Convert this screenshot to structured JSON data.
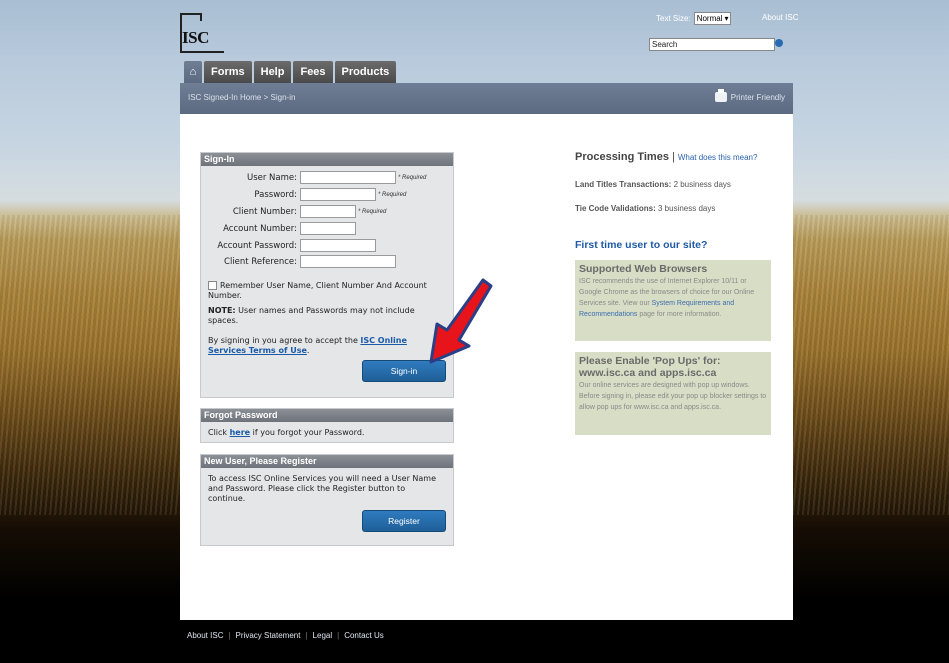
{
  "header": {
    "logo_text": "ISC",
    "text_size_label": "Text Size:",
    "text_size_value": "Normal",
    "about_label": "About ISC",
    "search_value": "Search"
  },
  "tabs": [
    {
      "label": ""
    },
    {
      "label": "Forms"
    },
    {
      "label": "Help"
    },
    {
      "label": "Fees"
    },
    {
      "label": "Products"
    }
  ],
  "breadcrumb": {
    "home": "ISC Signed-In Home",
    "sep": ">",
    "current": "Sign-in"
  },
  "printer_label": "Printer Friendly",
  "signin": {
    "title": "Sign-In",
    "fields": [
      {
        "label": "User Name:",
        "required": "* Required"
      },
      {
        "label": "Password:",
        "required": "* Required"
      },
      {
        "label": "Client Number:",
        "required": "* Required"
      },
      {
        "label": "Account Number:",
        "required": ""
      },
      {
        "label": "Account Password:",
        "required": ""
      },
      {
        "label": "Client Reference:",
        "required": ""
      }
    ],
    "remember": "Remember User Name, Client Number And Account Number.",
    "note_bold": "NOTE:",
    "note": "User names and Passwords may not include spaces.",
    "terms_prefix": "By signing in you agree to accept the",
    "terms_link": "ISC Online Services Terms of Use",
    "terms_suffix": ".",
    "button": "Sign-in"
  },
  "forgot": {
    "title": "Forgot Password",
    "prefix": "Click",
    "link": "here",
    "suffix": "if you forgot your Password."
  },
  "register": {
    "title": "New User, Please Register",
    "text": "To access ISC Online Services you will need a User Name and Password. Please click the Register button to continue.",
    "button": "Register"
  },
  "processing": {
    "title": "Processing Times",
    "sep": "|",
    "link": "What does this mean?",
    "land_label": "Land Titles Transactions:",
    "land_value": "2 business days",
    "tie_label": "Tie Code Validations:",
    "tie_value": "3 business days"
  },
  "first_time": "First time user to our site?",
  "browsers": {
    "title": "Supported Web Browsers",
    "text1": "ISC recommends the use of Internet Explorer 10/11 or Google Chrome as the browsers of choice for our Online Services site. View our",
    "link": "System Requirements and Recommendations",
    "text2": "page for more information."
  },
  "popups": {
    "title": "Please Enable 'Pop Ups' for: www.isc.ca and apps.isc.ca",
    "text": "Our online services are designed with pop up windows. Before signing in, please edit your pop up blocker settings to allow pop ups for www.isc.ca and apps.isc.ca."
  },
  "footer": [
    "About ISC",
    "Privacy Statement",
    "Legal",
    "Contact Us"
  ],
  "colors": {
    "header_bar": "#5b6a80",
    "accent_blue": "#1f5f98",
    "arrow_red": "#e8141b"
  }
}
